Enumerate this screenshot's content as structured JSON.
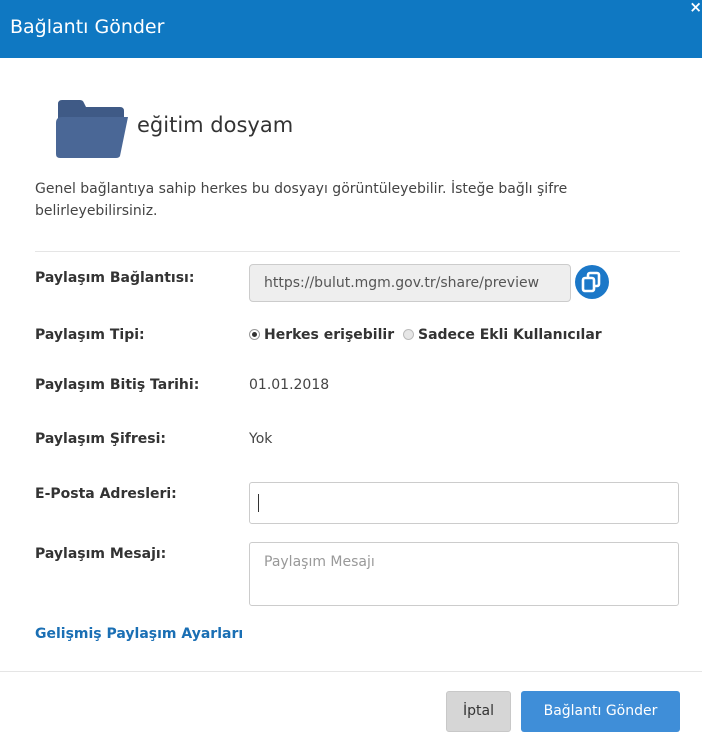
{
  "dialog": {
    "title": "Bağlantı Gönder",
    "close_symbol": "×"
  },
  "file": {
    "icon": "folder-icon",
    "name": "eğitim dosyam"
  },
  "description": "Genel bağlantıya sahip herkes bu dosyayı görüntüleyebilir. İsteğe bağlı şifre belirleyebilirsiniz.",
  "fields": {
    "share_link_label": "Paylaşım Bağlantısı:",
    "share_link_value": "https://bulut.mgm.gov.tr/share/preview",
    "copy_icon": "copy-icon",
    "share_type_label": "Paylaşım Tipi:",
    "share_type_options": [
      "Herkes erişebilir",
      "Sadece Ekli Kullanıcılar"
    ],
    "share_type_selected": "Herkes erişebilir",
    "expiry_label": "Paylaşım Bitiş Tarihi:",
    "expiry_value": "01.01.2018",
    "password_label": "Paylaşım Şifresi:",
    "password_value": "Yok",
    "emails_label": "E-Posta Adresleri:",
    "emails_value": "",
    "message_label": "Paylaşım Mesajı:",
    "message_placeholder": "Paylaşım Mesajı"
  },
  "advanced_link": "Gelişmiş Paylaşım Ayarları",
  "buttons": {
    "cancel": "İptal",
    "send": "Bağlantı Gönder"
  },
  "colors": {
    "header": "#0f78c2",
    "primary_button": "#3f8ed8",
    "link": "#1a6fb4",
    "folder": "#4a6796"
  }
}
